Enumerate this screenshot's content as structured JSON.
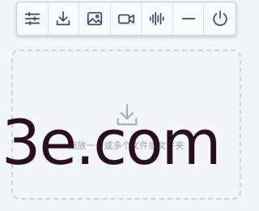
{
  "toolbar": {
    "buttons": [
      {
        "icon": "sliders-icon"
      },
      {
        "icon": "download-icon"
      },
      {
        "icon": "image-icon"
      },
      {
        "icon": "video-camera-icon"
      },
      {
        "icon": "audio-waveform-icon"
      },
      {
        "icon": "minimize-icon"
      },
      {
        "icon": "power-icon"
      }
    ]
  },
  "drop_zone": {
    "icon": "download-icon",
    "hint": "拖放一个或多个文件或文件夹"
  },
  "watermark": {
    "text": "3e.com"
  },
  "colors": {
    "icon": "#2f4a66",
    "border": "#c9d3df",
    "dashed": "#cfd5dd",
    "watermark": "#2b0f1f"
  }
}
